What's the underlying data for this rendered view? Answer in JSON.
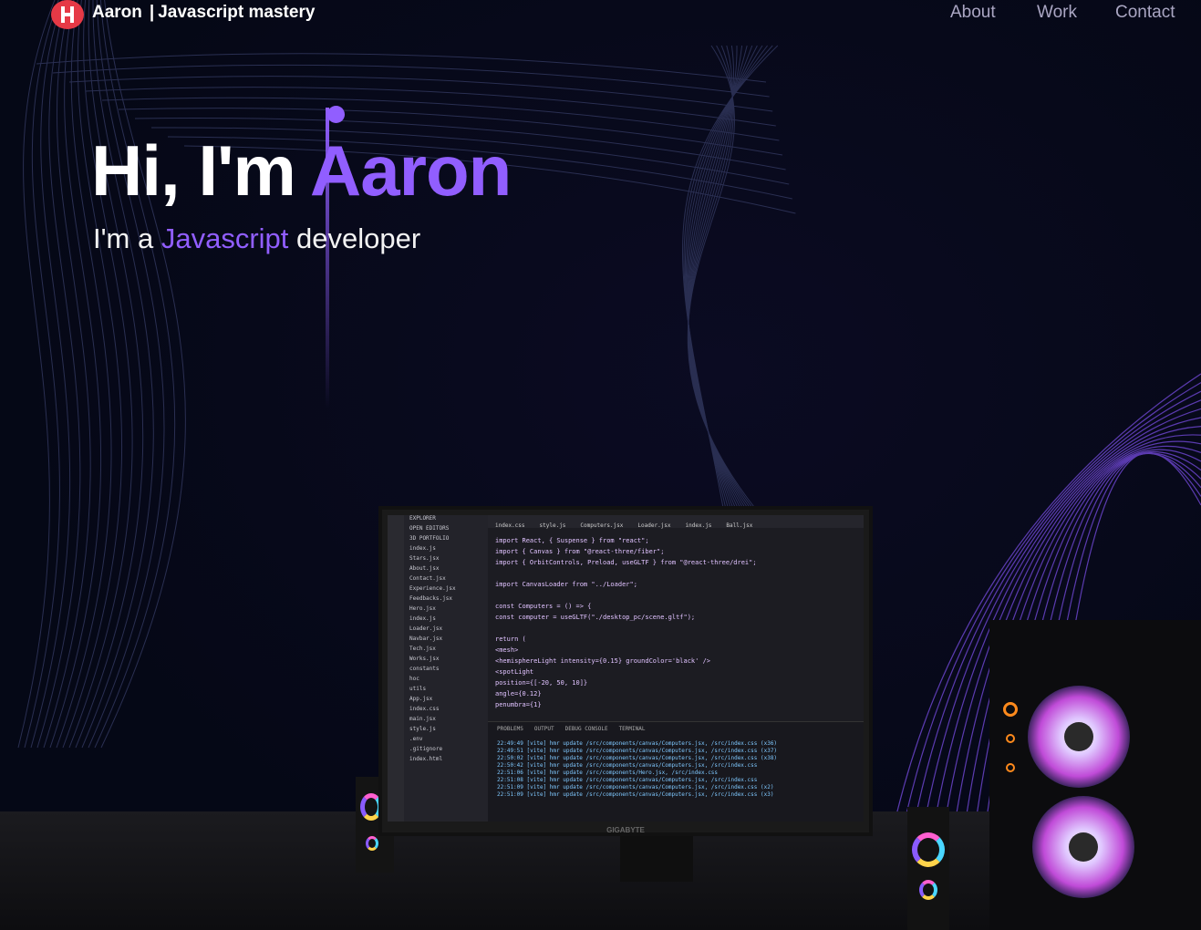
{
  "nav": {
    "name": "Aaron",
    "separator": "|",
    "tagline": "Javascript mastery",
    "links": [
      "About",
      "Work",
      "Contact"
    ]
  },
  "hero": {
    "greeting": "Hi, I'm",
    "name": "Aaron",
    "sub_prefix": "I'm a",
    "sub_accent": "Javascript",
    "sub_suffix": "developer"
  },
  "editor": {
    "explorer_items": [
      "EXPLORER",
      "OPEN EDITORS",
      "3D PORTFOLIO",
      "index.js",
      "Stars.jsx",
      "About.jsx",
      "Contact.jsx",
      "Experience.jsx",
      "Feedbacks.jsx",
      "Hero.jsx",
      "index.js",
      "Loader.jsx",
      "Navbar.jsx",
      "Tech.jsx",
      "Works.jsx",
      "constants",
      "hoc",
      "utils",
      "App.jsx",
      "index.css",
      "main.jsx",
      "style.js",
      ".env",
      ".gitignore",
      "index.html"
    ],
    "tabs": [
      "index.css",
      "style.js",
      "Computers.jsx",
      "Loader.jsx",
      "index.js",
      "Ball.jsx"
    ],
    "code_lines": [
      "import React, { Suspense } from \"react\";",
      "import { Canvas } from \"@react-three/fiber\";",
      "import { OrbitControls, Preload, useGLTF } from \"@react-three/drei\";",
      "",
      "import CanvasLoader from \"../Loader\";",
      "",
      "const Computers = () => {",
      "  const computer = useGLTF(\"./desktop_pc/scene.gltf\");",
      "",
      "  return (",
      "    <mesh>",
      "      <hemisphereLight intensity={0.15} groundColor='black' />",
      "      <spotLight",
      "        position={[-20, 50, 10]}",
      "        angle={0.12}",
      "        penumbra={1}"
    ],
    "terminal_tabs": [
      "PROBLEMS",
      "OUTPUT",
      "DEBUG CONSOLE",
      "TERMINAL"
    ],
    "terminal_lines": [
      "22:49:49 [vite] hmr update /src/components/canvas/Computers.jsx, /src/index.css (x36)",
      "22:49:51 [vite] hmr update /src/components/canvas/Computers.jsx, /src/index.css (x37)",
      "22:50:02 [vite] hmr update /src/components/canvas/Computers.jsx, /src/index.css (x38)",
      "22:50:42 [vite] hmr update /src/components/canvas/Computers.jsx, /src/index.css",
      "22:51:06 [vite] hmr update /src/components/Hero.jsx, /src/index.css",
      "22:51:08 [vite] hmr update /src/components/canvas/Computers.jsx, /src/index.css",
      "22:51:09 [vite] hmr update /src/components/canvas/Computers.jsx, /src/index.css (x2)",
      "22:51:09 [vite] hmr update /src/components/canvas/Computers.jsx, /src/index.css (x3)"
    ],
    "monitor_brand": "GIGABYTE"
  },
  "colors": {
    "background": "#050816",
    "accent": "#915eff",
    "nav_link": "#aaa6c3",
    "logo": "#e63946"
  }
}
